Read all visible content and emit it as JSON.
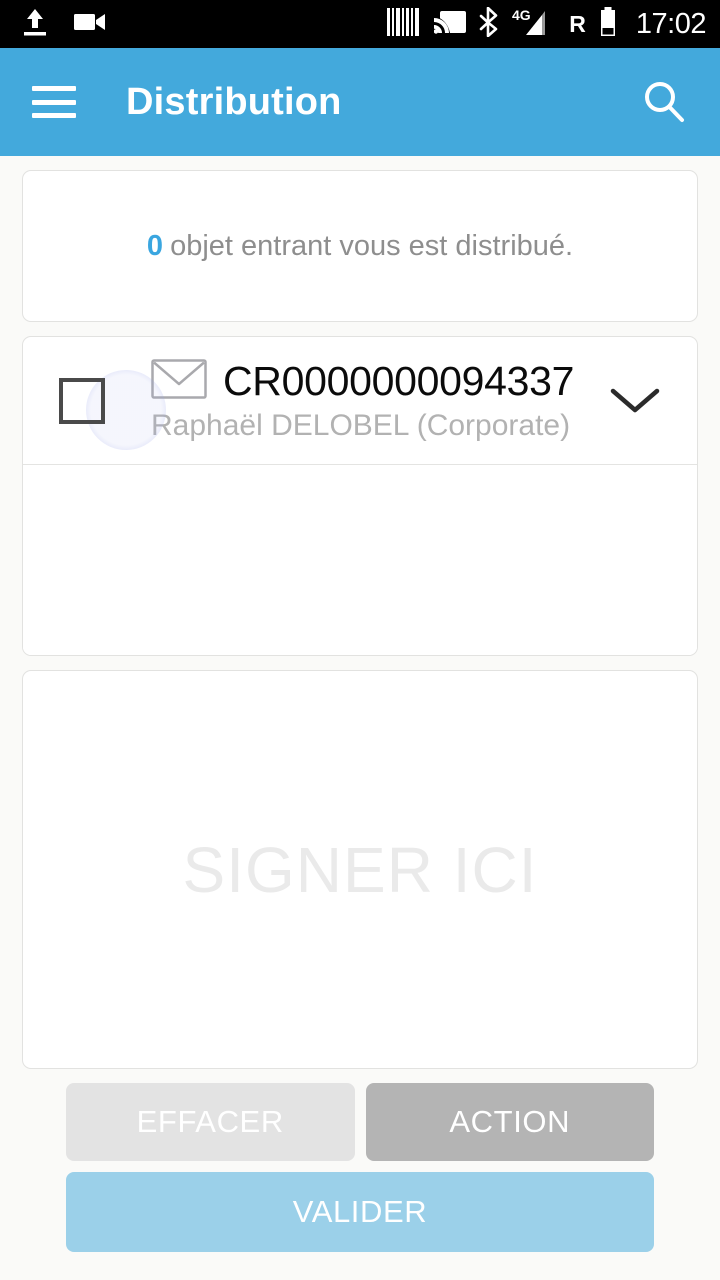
{
  "status_bar": {
    "icons_left": [
      "upload-icon",
      "video-camera-icon"
    ],
    "icons_right": [
      "barcode-icon",
      "cast-icon",
      "bluetooth-icon",
      "network-4g-icon",
      "roaming-icon",
      "battery-icon"
    ],
    "network_label": "4G",
    "roaming_label": "R",
    "clock": "17:02"
  },
  "app_bar": {
    "menu_icon": "hamburger-menu-icon",
    "title": "Distribution",
    "search_icon": "search-icon"
  },
  "info_card": {
    "count": "0",
    "message": "objet entrant vous est distribué."
  },
  "item": {
    "checkbox_checked": false,
    "type_icon": "envelope-icon",
    "reference": "CR0000000094337",
    "recipient": "Raphaël DELOBEL (Corporate)",
    "expand_icon": "chevron-down-icon"
  },
  "signature": {
    "placeholder": "SIGNER ICI"
  },
  "buttons": {
    "clear": "EFFACER",
    "action": "ACTION",
    "validate": "VALIDER"
  },
  "colors": {
    "app_bar": "#43a9dc",
    "accent": "#3aa6e0",
    "validate_button": "#9bd0e9",
    "action_button": "#b4b4b4",
    "clear_button": "#e3e3e3",
    "page_background": "#fafaf8",
    "card_background": "#ffffff",
    "card_border": "#e2e2e0"
  }
}
